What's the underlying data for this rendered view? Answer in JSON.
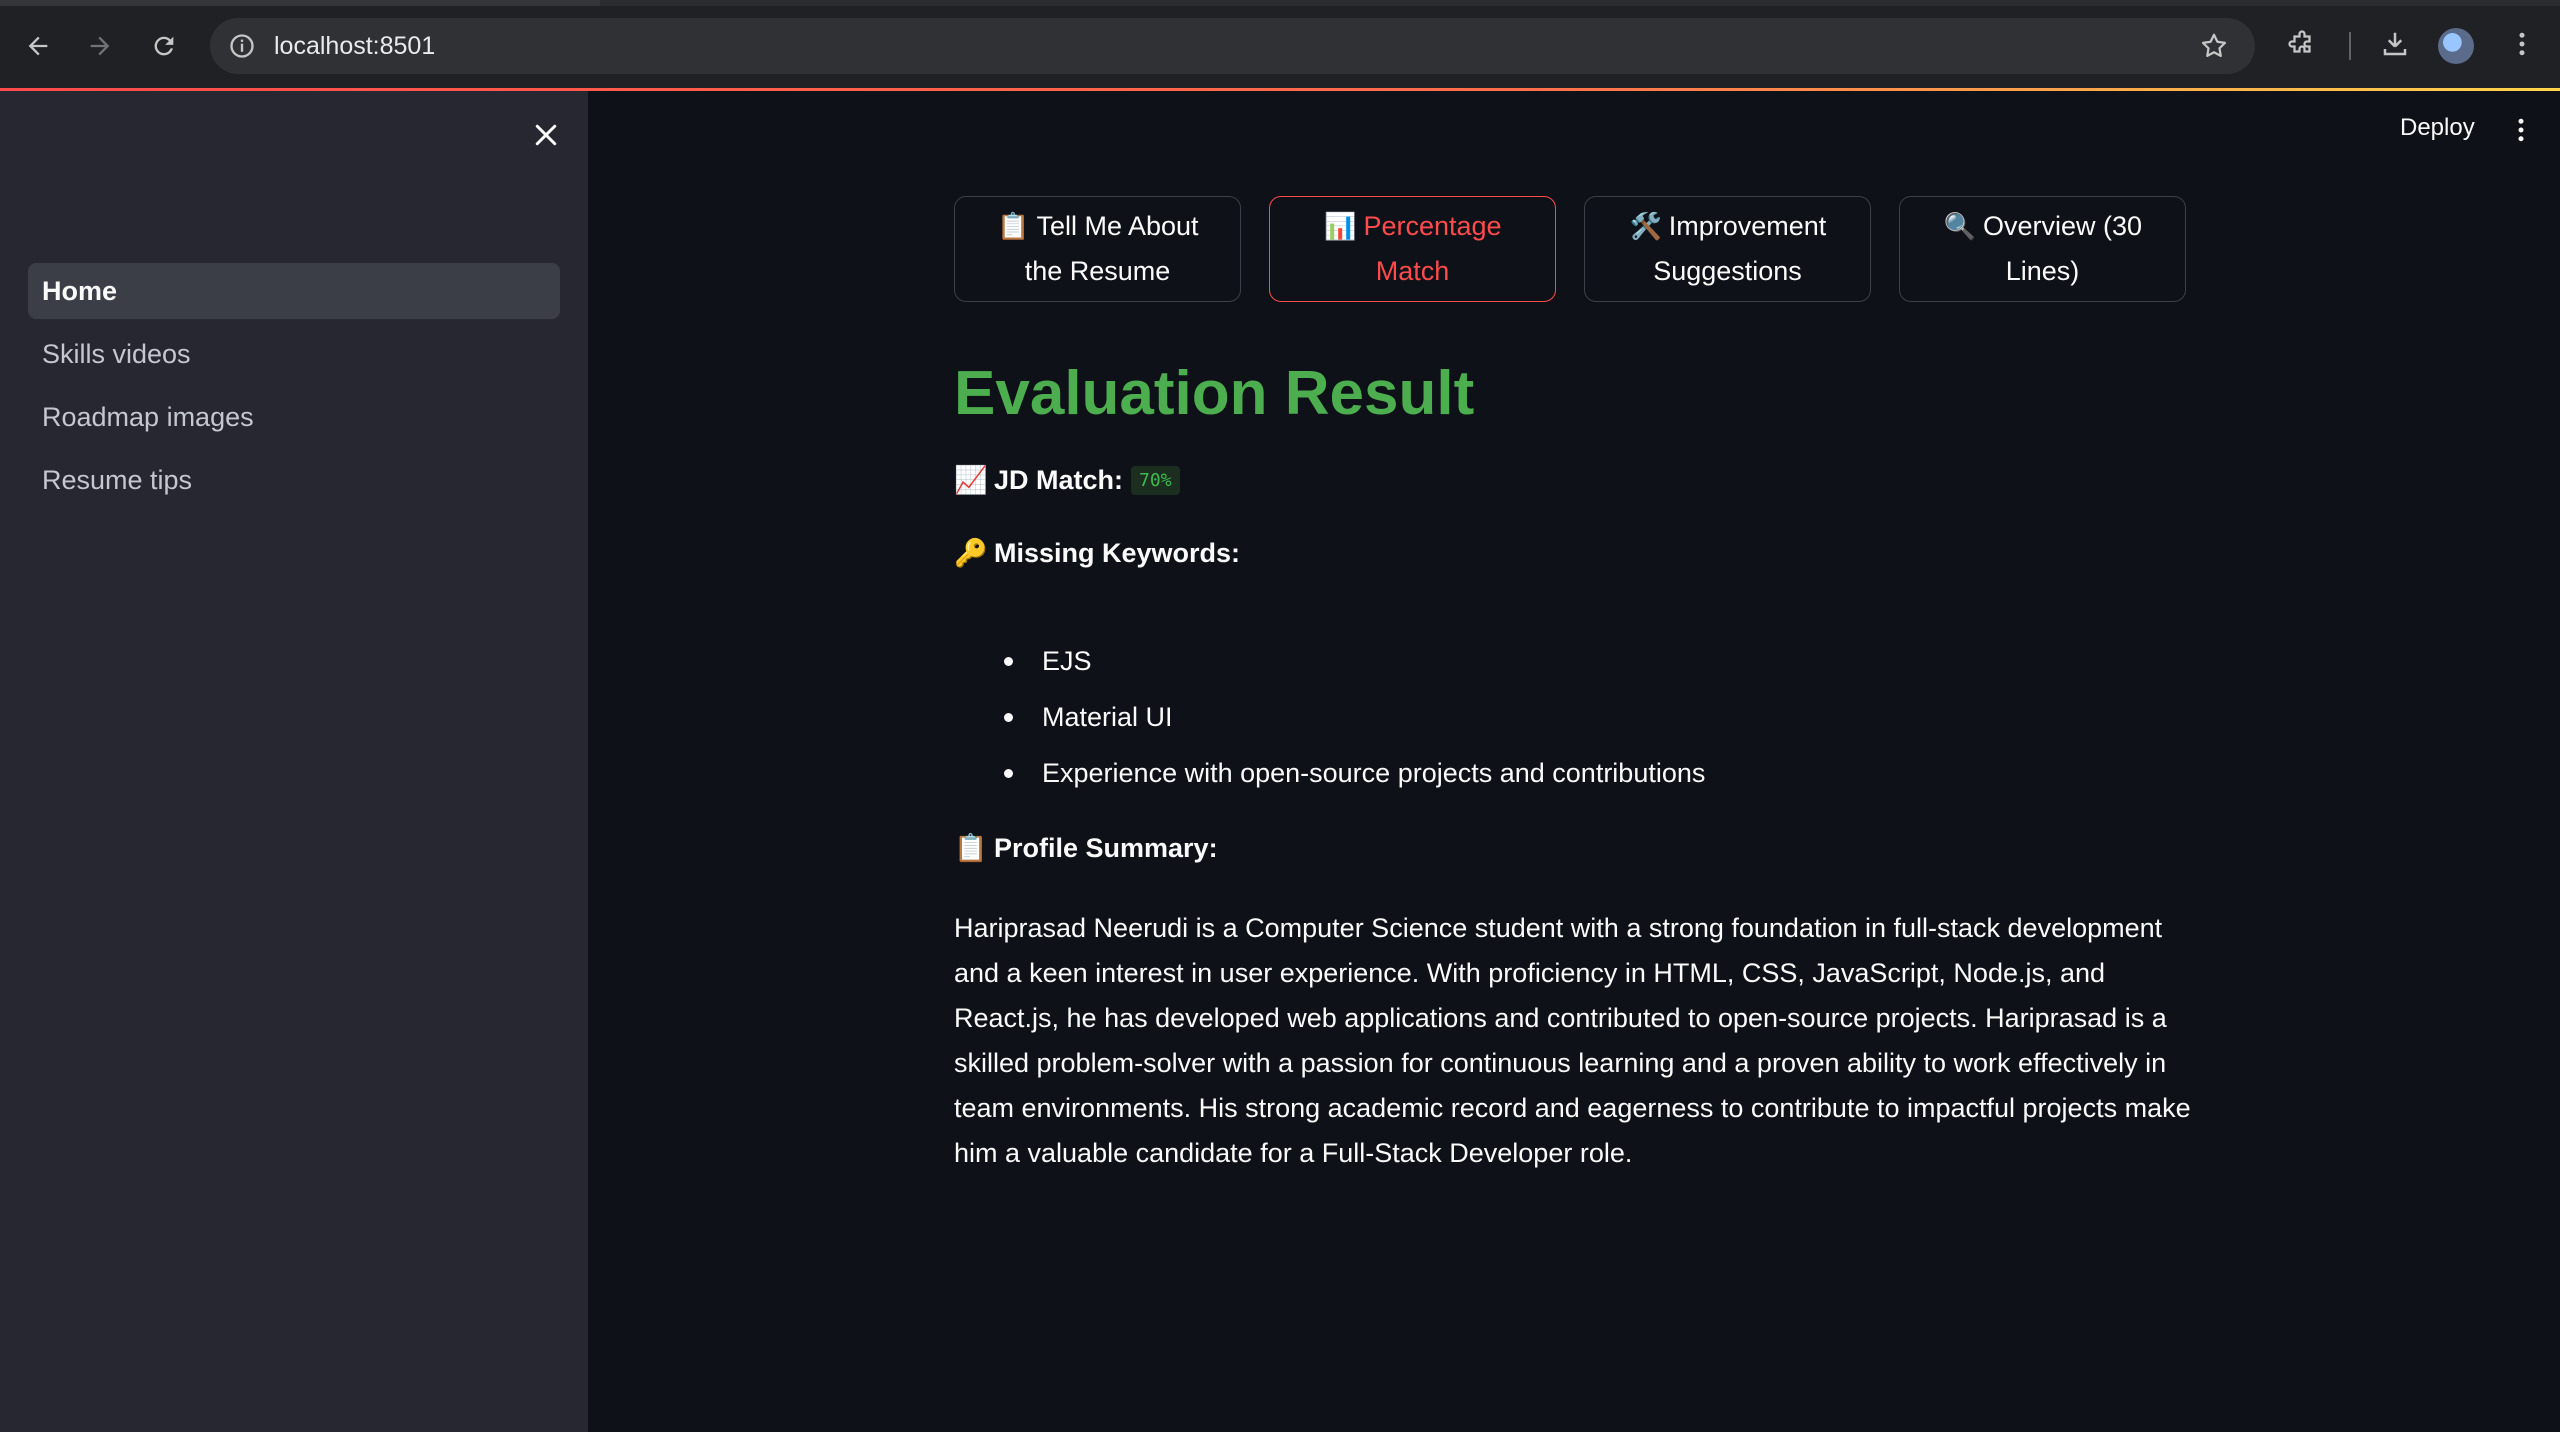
{
  "browser": {
    "url": "localhost:8501"
  },
  "sidebar": {
    "items": [
      {
        "label": "Home",
        "active": true
      },
      {
        "label": "Skills videos",
        "active": false
      },
      {
        "label": "Roadmap images",
        "active": false
      },
      {
        "label": "Resume tips",
        "active": false
      }
    ]
  },
  "header": {
    "deploy_label": "Deploy"
  },
  "tabs": [
    {
      "emoji": "📋",
      "label_line1": "Tell Me About",
      "label_line2": "the Resume",
      "selected": false
    },
    {
      "emoji": "📊",
      "label_line1": "Percentage",
      "label_line2": "Match",
      "selected": true
    },
    {
      "emoji": "🛠️",
      "label_line1": "Improvement",
      "label_line2": "Suggestions",
      "selected": false
    },
    {
      "emoji": "🔍",
      "label_line1": "Overview (30",
      "label_line2": "Lines)",
      "selected": false
    }
  ],
  "result": {
    "title": "Evaluation Result",
    "jd_match_emoji": "📈",
    "jd_match_label": "JD Match:",
    "jd_match_value": "70%",
    "missing_emoji": "🔑",
    "missing_label": "Missing Keywords:",
    "missing_keywords": [
      "EJS",
      "Material UI",
      "Experience with open-source projects and contributions"
    ],
    "profile_emoji": "📋",
    "profile_label": "Profile Summary:",
    "profile_summary": "Hariprasad Neerudi is a Computer Science student with a strong foundation in full-stack development and a keen interest in user experience. With proficiency in HTML, CSS, JavaScript, Node.js, and React.js, he has developed web applications and contributed to open-source projects. Hariprasad is a skilled problem-solver with a passion for continuous learning and a proven ability to work effectively in team environments. His strong academic record and eagerness to contribute to impactful projects make him a valuable candidate for a Full-Stack Developer role."
  },
  "colors": {
    "accent": "#ff4b4b",
    "title_green": "#4cae4f",
    "background": "#0e1117",
    "sidebar": "#262730"
  }
}
